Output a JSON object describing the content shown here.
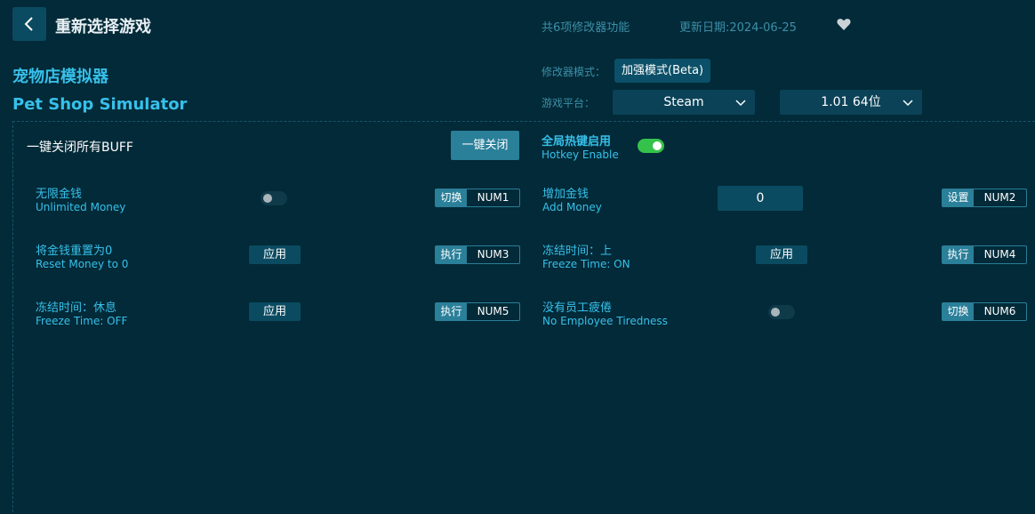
{
  "header": {
    "back_label": "重新选择游戏",
    "feature_count": "共6项修改器功能",
    "update_date": "更新日期:2024-06-25"
  },
  "game": {
    "title_cn": "宠物店模拟器",
    "title_en": "Pet Shop Simulator"
  },
  "settings": {
    "mode_label": "修改器模式：",
    "mode_value": "加强模式(Beta)",
    "platform_label": "游戏平台：",
    "platform_value": "Steam",
    "version_value": "1.01 64位"
  },
  "buff": {
    "label": "一键关闭所有BUFF",
    "button": "一键关闭"
  },
  "hotkey": {
    "label_cn": "全局热键启用",
    "label_en": "Hotkey Enable",
    "enabled": true
  },
  "options": [
    {
      "cn": "无限金钱",
      "en": "Unlimited Money",
      "action": "切换",
      "key": "NUM1",
      "toggle": false
    },
    {
      "cn": "增加金钱",
      "en": "Add Money",
      "action": "设置",
      "key": "NUM2",
      "value": "0"
    },
    {
      "cn": "将金钱重置为0",
      "en": "Reset Money to 0",
      "action": "执行",
      "key": "NUM3",
      "apply": "应用"
    },
    {
      "cn": "冻结时间：上",
      "en": "Freeze Time: ON",
      "action": "执行",
      "key": "NUM4",
      "apply": "应用"
    },
    {
      "cn": "冻结时间：休息",
      "en": "Freeze Time: OFF",
      "action": "执行",
      "key": "NUM5",
      "apply": "应用"
    },
    {
      "cn": "没有员工疲倦",
      "en": "No Employee Tiredness",
      "action": "切换",
      "key": "NUM6",
      "toggle": false
    }
  ],
  "colors": {
    "background": "#022a38",
    "accent": "#37c0ea",
    "button": "#2a7f99",
    "toggle_on": "#35c24a"
  }
}
